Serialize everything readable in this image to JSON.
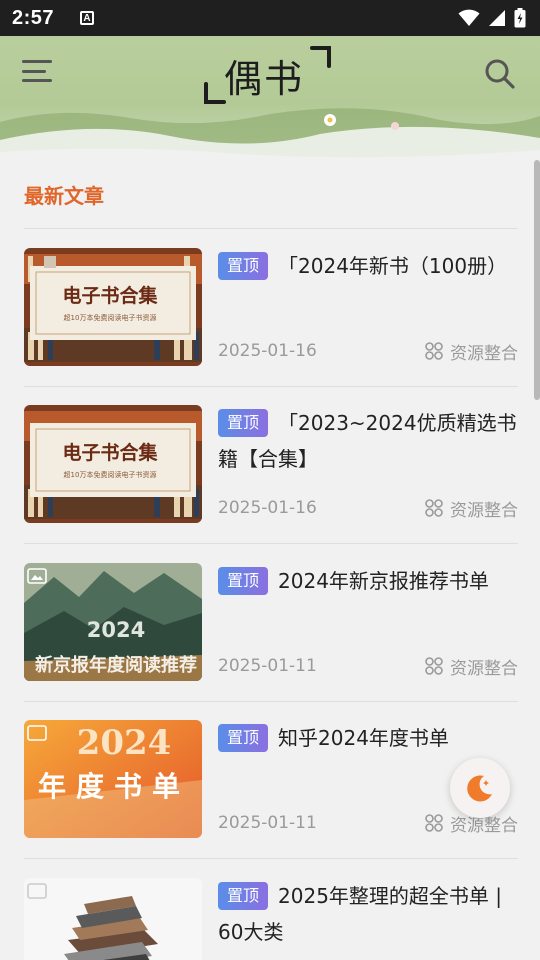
{
  "status_bar": {
    "time": "2:57",
    "notification_icon": "A"
  },
  "header": {
    "logo_text": "偶书",
    "menu_icon": "hamburger-menu-icon",
    "search_icon": "search-icon"
  },
  "section": {
    "title": "最新文章"
  },
  "badge_label": "置顶",
  "articles": [
    {
      "title": "「2024年新书（100册）",
      "date": "2025-01-16",
      "category": "资源整合",
      "thumb": {
        "heading": "电子书合集",
        "sub": "超10万本免费阅读电子书资源"
      }
    },
    {
      "title": "「2023~2024优质精选书籍【合集】",
      "date": "2025-01-16",
      "category": "资源整合",
      "thumb": {
        "heading": "电子书合集",
        "sub": "超10万本免费阅读电子书资源"
      }
    },
    {
      "title": "2024年新京报推荐书单",
      "date": "2025-01-11",
      "category": "资源整合",
      "thumb": {
        "heading": "2024",
        "sub": "新京报年度阅读推荐"
      }
    },
    {
      "title": "知乎2024年度书单",
      "date": "2025-01-11",
      "category": "资源整合",
      "thumb": {
        "heading": "2024",
        "sub": "年度书单"
      }
    },
    {
      "title": "2025年整理的超全书单 | 60大类",
      "date": "",
      "category": "",
      "thumb": {
        "heading": "",
        "sub": ""
      }
    }
  ],
  "colors": {
    "accent": "#e0662a",
    "badge_start": "#5a8ee8",
    "badge_end": "#8b6fe0"
  }
}
